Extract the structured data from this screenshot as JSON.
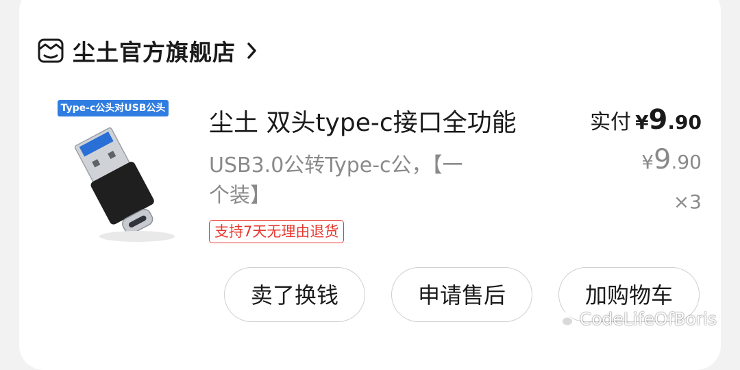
{
  "shop": {
    "name": "尘土官方旗舰店",
    "icon": "shop-icon"
  },
  "product": {
    "image_tag": "Type-c公头对USB公头",
    "title": "尘土 双头type-c接口全功能",
    "subtitle_line1": "USB3.0公转Type-c公，【一",
    "subtitle_line2": "个装】",
    "return_badge": "支持7天无理由退货"
  },
  "price": {
    "paid_label": "实付",
    "currency": "¥",
    "paid_int": "9",
    "paid_dec": ".90",
    "unit_int": "9",
    "unit_dec": ".90",
    "quantity": "×3"
  },
  "actions": {
    "sell": "卖了换钱",
    "after_sale": "申请售后",
    "add_cart": "加购物车"
  },
  "watermark": {
    "text": "CodeLifeOfBoris"
  },
  "colors": {
    "accent_red": "#e8372e",
    "tag_blue": "#2f7de1",
    "text_primary": "#1a1a1a",
    "text_secondary": "#8a8a8a"
  }
}
